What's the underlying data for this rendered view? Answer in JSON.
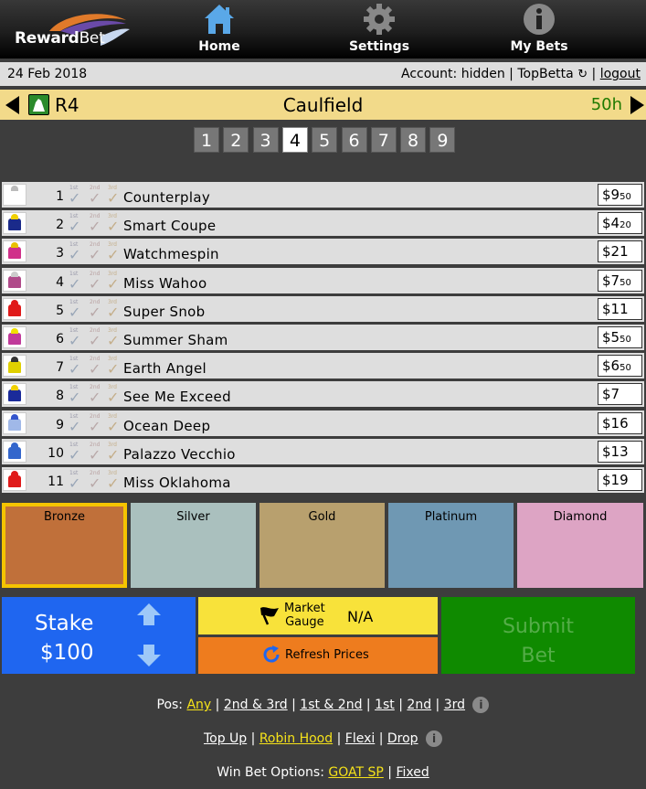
{
  "header": {
    "logo_text": "Reward",
    "logo_text2": "Bet",
    "nav": [
      {
        "label": "Home",
        "icon": "home-icon"
      },
      {
        "label": "Settings",
        "icon": "gear-icon"
      },
      {
        "label": "My Bets",
        "icon": "info-icon"
      }
    ]
  },
  "infobar": {
    "date": "24 Feb 2018",
    "account_prefix": "Account: hidden | TopBetta",
    "logout": "logout"
  },
  "race": {
    "number": "R4",
    "venue": "Caulfield",
    "time_left": "50h"
  },
  "race_tabs": [
    "1",
    "2",
    "3",
    "4",
    "5",
    "6",
    "7",
    "8",
    "9"
  ],
  "active_race": "4",
  "placings": [
    "1st",
    "2nd",
    "3rd"
  ],
  "runners": [
    {
      "num": "1",
      "name": "Counterplay",
      "price": "$9",
      "cents": "50",
      "silk_body": "#ffffff",
      "silk_cap": "#bbbbbb"
    },
    {
      "num": "2",
      "name": "Smart Coupe",
      "price": "$4",
      "cents": "20",
      "silk_body": "#1a2a8a",
      "silk_cap": "#f0d000"
    },
    {
      "num": "3",
      "name": "Watchmespin",
      "price": "$21",
      "cents": "",
      "silk_body": "#d0308a",
      "silk_cap": "#e8c000"
    },
    {
      "num": "4",
      "name": "Miss Wahoo",
      "price": "$7",
      "cents": "50",
      "silk_body": "#b04a8a",
      "silk_cap": "#cccccc"
    },
    {
      "num": "5",
      "name": "Super Snob",
      "price": "$11",
      "cents": "",
      "silk_body": "#e01a1a",
      "silk_cap": "#e01a1a"
    },
    {
      "num": "6",
      "name": "Summer Sham",
      "price": "$5",
      "cents": "50",
      "silk_body": "#c03a9a",
      "silk_cap": "#f0e000"
    },
    {
      "num": "7",
      "name": "Earth Angel",
      "price": "$6",
      "cents": "50",
      "silk_body": "#e0d000",
      "silk_cap": "#333333"
    },
    {
      "num": "8",
      "name": "See Me Exceed",
      "price": "$7",
      "cents": "",
      "silk_body": "#1a2a9a",
      "silk_cap": "#f0d000"
    },
    {
      "num": "9",
      "name": "Ocean Deep",
      "price": "$16",
      "cents": "",
      "silk_body": "#a0b8e8",
      "silk_cap": "#3355cc"
    },
    {
      "num": "10",
      "name": "Palazzo Vecchio",
      "price": "$13",
      "cents": "",
      "silk_body": "#3366cc",
      "silk_cap": "#3366cc"
    },
    {
      "num": "11",
      "name": "Miss Oklahoma",
      "price": "$19",
      "cents": "",
      "silk_body": "#e01a1a",
      "silk_cap": "#e01a1a"
    }
  ],
  "tiers": [
    {
      "label": "Bronze",
      "color": "#c0703a"
    },
    {
      "label": "Silver",
      "color": "#aac0be"
    },
    {
      "label": "Gold",
      "color": "#b8a06e"
    },
    {
      "label": "Platinum",
      "color": "#6f98b3"
    },
    {
      "label": "Diamond",
      "color": "#dda4c4"
    }
  ],
  "selected_tier": "Bronze",
  "stake": {
    "label": "Stake",
    "value": "$100"
  },
  "market_gauge": {
    "label_line1": "Market",
    "label_line2": "Gauge",
    "value": "N/A"
  },
  "refresh": {
    "label": "Refresh Prices"
  },
  "submit": {
    "line1": "Submit",
    "line2": "Bet"
  },
  "pos_options": {
    "prefix": "Pos:",
    "items": [
      "Any",
      "2nd & 3rd",
      "1st & 2nd",
      "1st",
      "2nd",
      "3rd"
    ]
  },
  "bet_types": {
    "items": [
      "Top Up",
      "Robin Hood",
      "Flexi",
      "Drop"
    ]
  },
  "win_options": {
    "prefix": "Win Bet Options:",
    "items": [
      "GOAT SP",
      "Fixed"
    ]
  }
}
